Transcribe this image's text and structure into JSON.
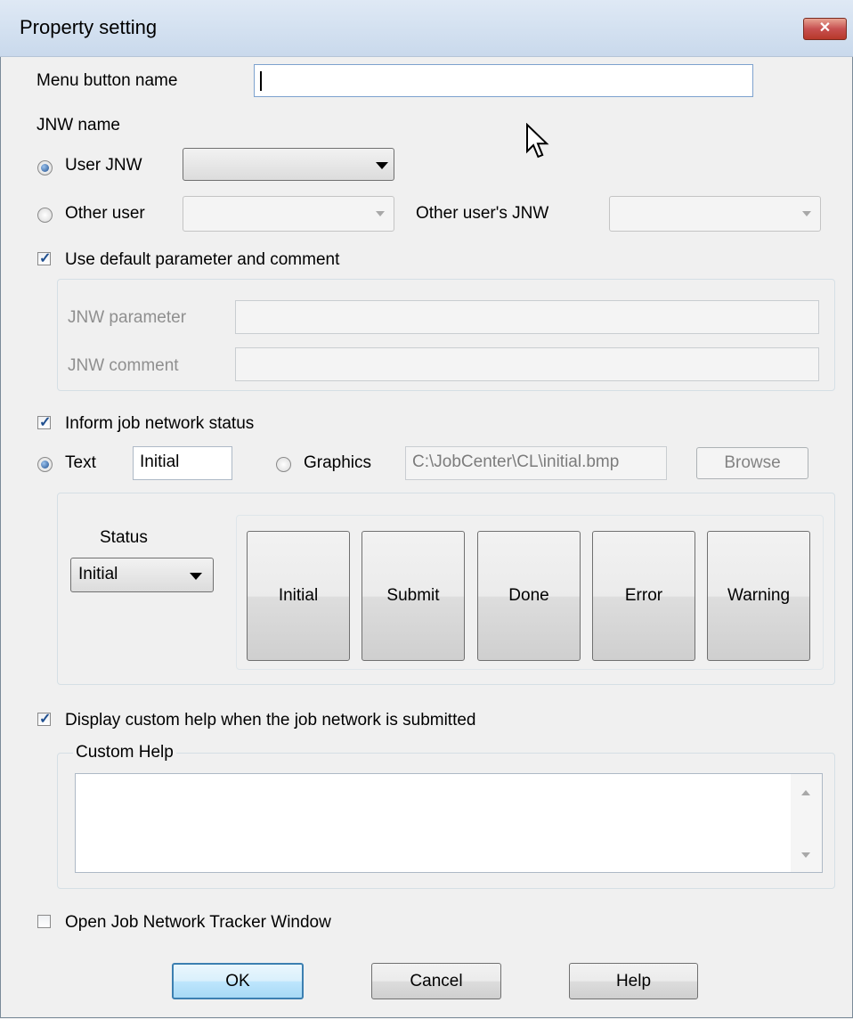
{
  "window": {
    "title": "Property setting",
    "close_glyph": "✕"
  },
  "menu_button_name": {
    "label": "Menu button name",
    "value": ""
  },
  "jnw": {
    "section_label": "JNW name",
    "user_jnw_label": "User JNW",
    "user_jnw_selected": true,
    "user_jnw_value": "",
    "other_user_label": "Other user",
    "other_user_selected": false,
    "other_user_value": "",
    "other_users_jnw_label": "Other user's JNW",
    "other_users_jnw_value": ""
  },
  "default_params": {
    "checkbox_label": "Use default parameter and comment",
    "checked": true,
    "parameter_label": "JNW parameter",
    "parameter_value": "",
    "comment_label": "JNW comment",
    "comment_value": ""
  },
  "status_inform": {
    "checkbox_label": "Inform job network status",
    "checked": true,
    "text_label": "Text",
    "text_selected": true,
    "text_value": "Initial",
    "graphics_label": "Graphics",
    "graphics_selected": false,
    "graphics_path": "C:\\JobCenter\\CL\\initial.bmp",
    "browse_label": "Browse",
    "status_label": "Status",
    "status_selected": "Initial",
    "status_buttons": [
      "Initial",
      "Submit",
      "Done",
      "Error",
      "Warning"
    ]
  },
  "custom_help": {
    "checkbox_label": "Display custom help when the job network is submitted",
    "checked": true,
    "group_label": "Custom Help",
    "text": ""
  },
  "tracker": {
    "checkbox_label": "Open Job Network Tracker Window",
    "checked": false
  },
  "buttons": {
    "ok": "OK",
    "cancel": "Cancel",
    "help": "Help"
  },
  "colors": {
    "dialog_bg": "#f0f0f0",
    "titlebar": "#c9d9ec",
    "close_button": "#c75050",
    "selection_blue": "#1f4f8f",
    "default_button_border": "#3c7fb1"
  },
  "icons": {
    "close": "close-icon",
    "dropdown": "chevron-down-icon",
    "cursor": "mouse-pointer-icon"
  }
}
